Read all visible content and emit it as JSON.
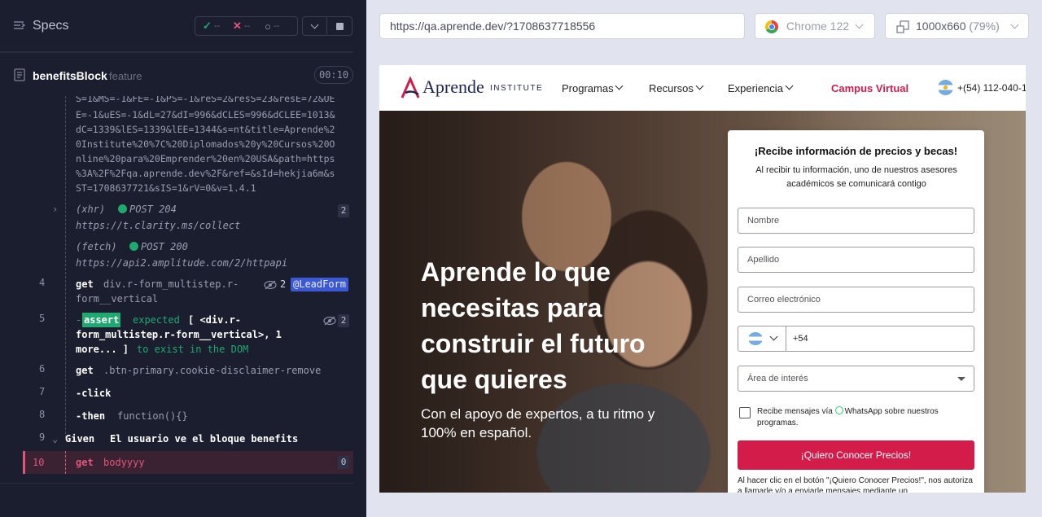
{
  "reporter": {
    "title": "Specs",
    "stats": {
      "passed": "--",
      "failed": "--",
      "pending": "--"
    },
    "file": {
      "name": "benefitsBlock",
      "tag": "feature",
      "duration": "00:10"
    },
    "log": {
      "url_lines": [
        "S=1&MS=-1&FE=-1&PS=-1&reS=2&resS=23&resE=72&UE",
        "E=-1&uES=-1&dL=27&dI=996&dCLES=996&dCLEE=1013&",
        "dC=1339&lES=1339&lEE=1344&s=nt&title=Aprende%2",
        "0Institute%20%7C%20Diplomados%20y%20Cursos%20O",
        "nline%20para%20Emprender%20en%20USA&path=https",
        "%3A%2F%2Fqa.aprende.dev%2F&ref=&sId=hekjia6m&s",
        "ST=1708637721&sIS=1&rV=0&v=1.4.1"
      ],
      "xhr": {
        "kind": "(xhr)",
        "method": "POST 204",
        "url": "https://t.clarity.ms/collect",
        "count": "2"
      },
      "fetch": {
        "kind": "(fetch)",
        "method": "POST 200",
        "url": "https://api2.amplitude.com/2/httpapi"
      },
      "row4": {
        "num": "4",
        "cmd": "get",
        "arg1": "div.r-form_multistep.r-",
        "arg2": "form__vertical",
        "count": "2",
        "alias": "@LeadForm"
      },
      "row5": {
        "num": "5",
        "prefix": "-",
        "cmd": "assert",
        "l1a": "expected",
        "l1b": "[ <div.r-",
        "l2": "form_multistep.r-form__vertical>, 1",
        "l3a": "more... ]",
        "l3b": "to exist in the DOM",
        "count": "2"
      },
      "row6": {
        "num": "6",
        "cmd": "get",
        "arg": ".btn-primary.cookie-disclaimer-remove"
      },
      "row7": {
        "num": "7",
        "cmd": "-click"
      },
      "row8": {
        "num": "8",
        "cmd": "-then",
        "arg": "function(){}"
      },
      "row9": {
        "num": "9",
        "cmd": "Given",
        "arg": "El usuario ve el bloque benefits"
      },
      "row10": {
        "num": "10",
        "cmd": "get",
        "arg": "bodyyyy",
        "count": "0"
      }
    }
  },
  "browser": {
    "url": "https://qa.aprende.dev/?1708637718556",
    "name": "Chrome 122",
    "viewport": "1000x660",
    "zoom": "(79%)"
  },
  "site": {
    "brand": "Aprende",
    "brand_sub": "INSTITUTE",
    "nav": [
      "Programas",
      "Recursos",
      "Experiencia"
    ],
    "campus": "Campus Virtual",
    "phone": "+(54) 112-040-1",
    "hero_title": "Aprende lo que necesitas para construir el futuro que quieres",
    "hero_sub": "Con el apoyo de expertos, a tu ritmo y 100% en español.",
    "form": {
      "title": "¡Recibe información de precios y becas!",
      "desc": "Al recibir tu información, uno de nuestros asesores académicos se comunicará contigo",
      "nombre": "Nombre",
      "apellido": "Apellido",
      "correo": "Correo electrónico",
      "phone_code": "+54",
      "area": "Área de interés",
      "consent_pre": "Recibe mensajes vía",
      "consent_post": "WhatsApp sobre nuestros programas.",
      "submit": "¡Quiero Conocer Precios!",
      "legal": "Al hacer clic en el botón \"¡Quiero Conocer Precios!\", nos autoriza a llamarle y/o a enviarle mensajes mediante un"
    }
  }
}
